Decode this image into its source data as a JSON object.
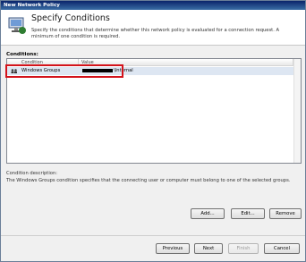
{
  "window": {
    "title": "New Network Policy"
  },
  "header": {
    "title": "Specify Conditions",
    "description": "Specify the conditions that determine whether this network policy is evaluated for a connection request. A minimum of one condition is required."
  },
  "conditions": {
    "label": "Conditions:",
    "columns": {
      "condition": "Condition",
      "value": "Value"
    },
    "rows": [
      {
        "condition": "Windows Groups",
        "value_suffix": "\\Internal"
      }
    ]
  },
  "condition_description": {
    "label": "Condition description:",
    "text": "The Windows Groups condition specifies that the connecting user or computer must belong to one of the selected groups."
  },
  "actions": {
    "add": "Add...",
    "edit": "Edit...",
    "remove": "Remove"
  },
  "footer": {
    "previous": "Previous",
    "next": "Next",
    "finish": "Finish",
    "cancel": "Cancel"
  },
  "colors": {
    "highlight": "#d3131b",
    "selected_row": "#dde6f2"
  }
}
